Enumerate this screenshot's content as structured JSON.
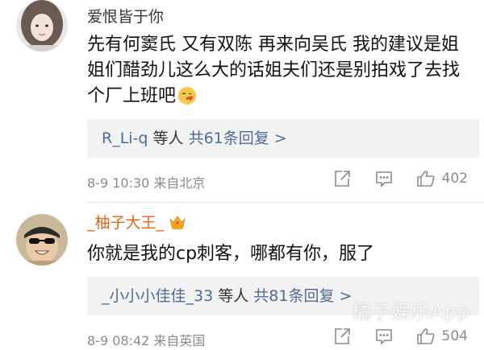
{
  "comments": [
    {
      "username": "爱恨皆于你",
      "text": "先有何窦氏 又有双陈 再来向吴氏 我的建议是姐姐们醋劲儿这么大的话姐夫们还是别拍戏了去找个厂上班吧",
      "emoji": "blowing-kiss-emoji",
      "reply_names": "R_Li-q",
      "reply_people": "等人",
      "reply_count": "共61条回复 >",
      "time": "8-9 10:30",
      "source": "来自北京",
      "likes": "402"
    },
    {
      "username": "_柚子大王_",
      "badge_icon": "crown-icon",
      "text": "你就是我的cp刺客，哪都有你，服了",
      "reply_names": "_小小小佳佳_33",
      "reply_people": "等人",
      "reply_count": "共81条回复 >",
      "time": "8-9 08:42",
      "source": "来自英国",
      "likes": "504"
    }
  ],
  "watermark": "橘子娱乐App",
  "colors": {
    "link": "#4e6f99",
    "vip_name": "#e8621b",
    "meta": "#8a8a8a",
    "reply_bg": "#f2f2f2"
  }
}
